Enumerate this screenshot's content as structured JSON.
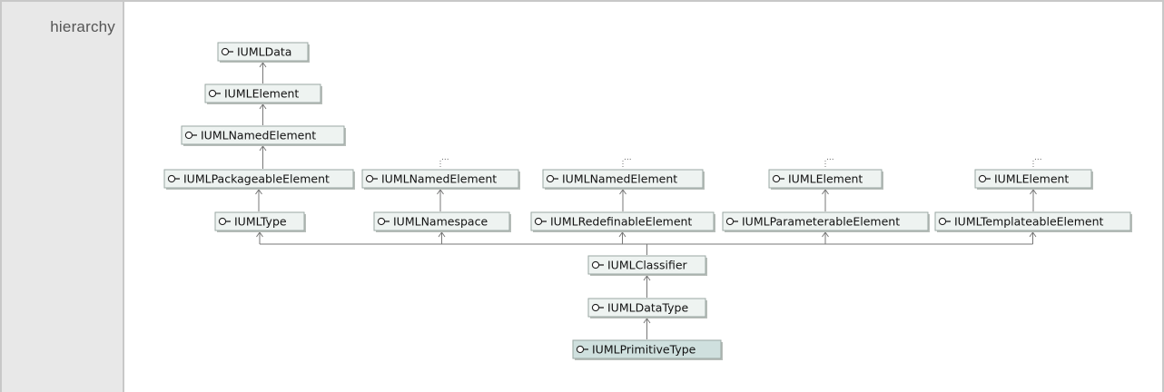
{
  "section_label": "hierarchy",
  "nodes": {
    "n_data": "IUMLData",
    "n_elem": "IUMLElement",
    "n_named": "IUMLNamedElement",
    "n_pkg": "IUMLPackageableElement",
    "n_type": "IUMLType",
    "n_named2": "IUMLNamedElement",
    "n_ns": "IUMLNamespace",
    "n_named3": "IUMLNamedElement",
    "n_redef": "IUMLRedefinableElement",
    "n_elem2": "IUMLElement",
    "n_param": "IUMLParameterableElement",
    "n_elem3": "IUMLElement",
    "n_templ": "IUMLTemplateableElement",
    "n_classifier": "IUMLClassifier",
    "n_datatype": "IUMLDataType",
    "n_prim": "IUMLPrimitiveType"
  },
  "more_marker": "..."
}
